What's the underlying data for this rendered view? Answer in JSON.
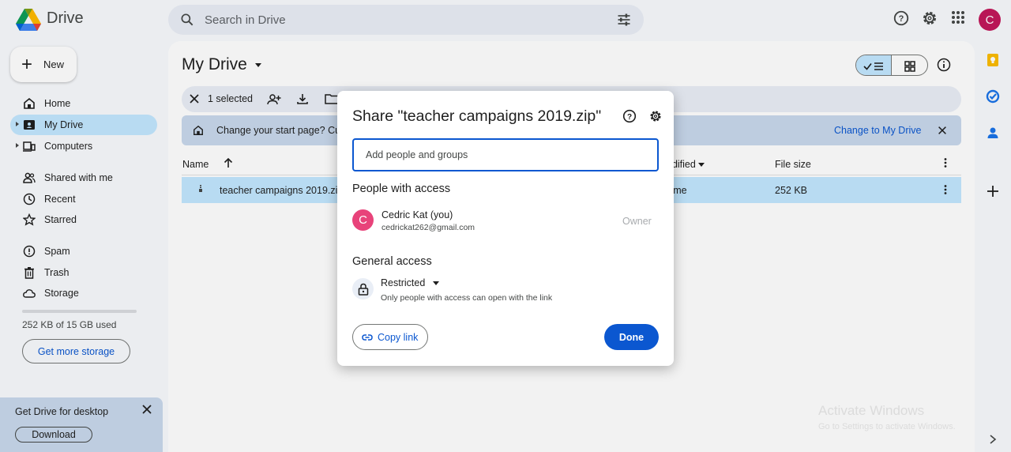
{
  "app": {
    "name": "Drive"
  },
  "search": {
    "placeholder": "Search in Drive"
  },
  "header": {
    "avatar_initial": "C"
  },
  "sidebar": {
    "new_label": "New",
    "items": [
      {
        "label": "Home"
      },
      {
        "label": "My Drive"
      },
      {
        "label": "Computers"
      },
      {
        "label": "Shared with me"
      },
      {
        "label": "Recent"
      },
      {
        "label": "Starred"
      },
      {
        "label": "Spam"
      },
      {
        "label": "Trash"
      },
      {
        "label": "Storage"
      }
    ],
    "storage_used_fraction": 1.68e-05,
    "storage_text": "252 KB of 15 GB used",
    "get_storage_label": "Get more storage"
  },
  "main": {
    "title": "My Drive",
    "selection": {
      "count_label": "1 selected"
    },
    "banner": {
      "text": "Change your start page? Cu",
      "action": "Change to My Drive"
    },
    "table": {
      "columns": {
        "name": "Name",
        "modified": "odified",
        "size": "File size"
      },
      "rows": [
        {
          "name": "teacher campaigns 2019.zip",
          "owner": "l me",
          "size": "252 KB"
        }
      ]
    }
  },
  "promo": {
    "title": "Get Drive for desktop",
    "download_label": "Download"
  },
  "watermark": {
    "line1": "Activate Windows",
    "line2": "Go to Settings to activate Windows."
  },
  "dialog": {
    "title": "Share \"teacher campaigns 2019.zip\"",
    "add_placeholder": "Add people and groups",
    "people_heading": "People with access",
    "person": {
      "initial": "C",
      "name": "Cedric Kat (you)",
      "email": "cedrickat262@gmail.com",
      "role": "Owner"
    },
    "general_heading": "General access",
    "access_level": "Restricted",
    "access_desc": "Only people with access can open with the link",
    "copy_link_label": "Copy link",
    "done_label": "Done"
  },
  "colors": {
    "accent": "#0b57d0",
    "selected_bg": "#c2e7ff",
    "avatar": "#e8437a"
  }
}
